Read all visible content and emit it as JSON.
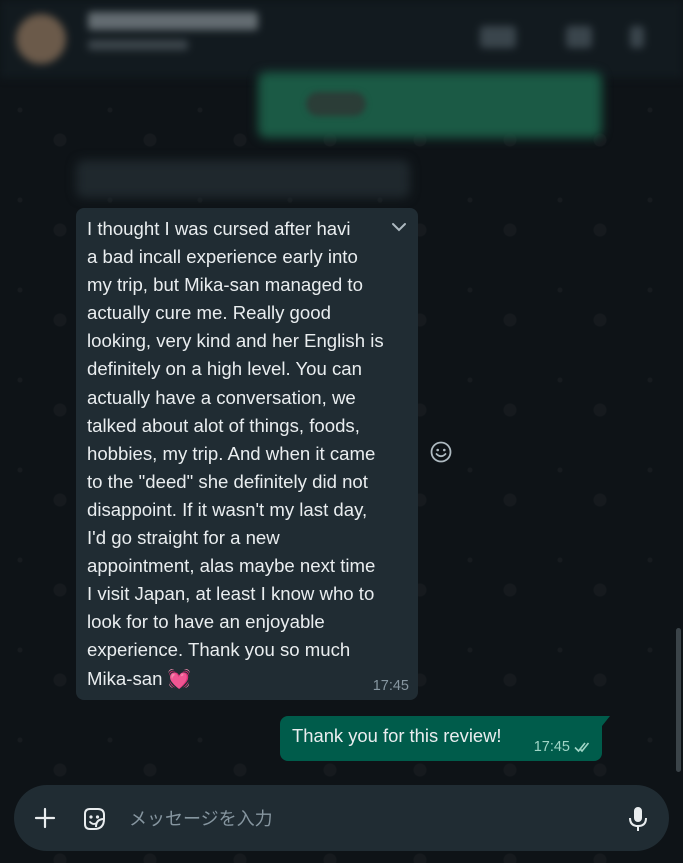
{
  "composer": {
    "placeholder": "メッセージを入力"
  },
  "messages": {
    "incoming": {
      "text": "I thought I was cursed after havi\na bad incall experience early into\nmy trip, but Mika-san managed to\nactually cure me. Really good\nlooking, very kind and her English is\ndefinitely on a high level. You can\nactually have a conversation, we\ntalked about alot of things, foods,\nhobbies, my trip. And when it came\nto the \"deed\" she definitely did not\ndisappoint. If it wasn't my last day,\nI'd go straight for a new\nappointment, alas maybe next time\nI visit Japan, at least I know who to\nlook for to have an enjoyable\nexperience. Thank you so much\nMika-san ",
      "emoji": "💓",
      "time": "17:45"
    },
    "outgoing": {
      "text": "Thank you for this review!",
      "time": "17:45",
      "status_icon": "double-check-icon"
    }
  },
  "colors": {
    "incoming_bubble": "#202c33",
    "outgoing_bubble": "#005c4b",
    "chat_background": "#0e1317"
  }
}
